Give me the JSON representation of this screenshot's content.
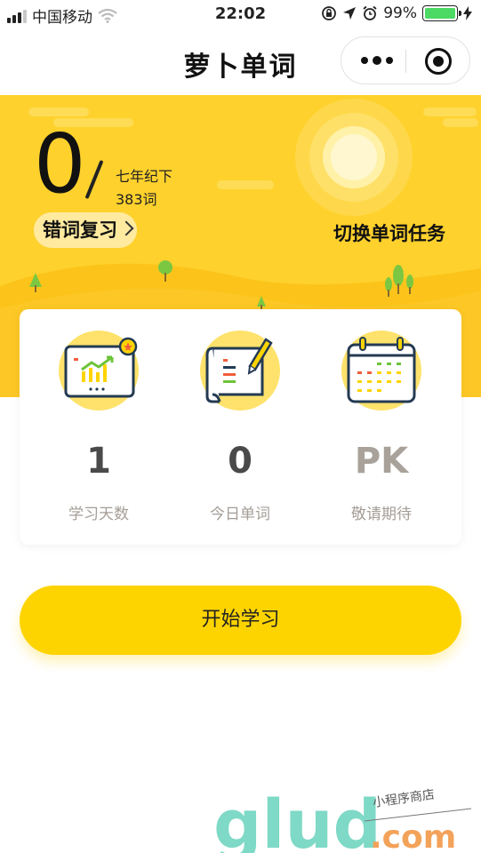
{
  "status_bar": {
    "carrier": "中国移动",
    "time": "22:02",
    "battery": "99%"
  },
  "nav": {
    "title": "萝卜单词"
  },
  "hero": {
    "word_count_big": "0",
    "book_name": "七年纪下",
    "book_total": "383词",
    "review_button": "错词复习",
    "switch_task": "切换单词任务"
  },
  "stats": [
    {
      "value": "1",
      "label": "学习天数",
      "icon": "chart-board-icon"
    },
    {
      "value": "0",
      "label": "今日单词",
      "icon": "scroll-list-icon"
    },
    {
      "value": "PK",
      "label": "敬请期待",
      "icon": "calendar-icon"
    }
  ],
  "start_button": "开始学习",
  "watermark": {
    "main": "glud",
    "suffix": ".com",
    "tagline": "小程序商店"
  },
  "colors": {
    "brand_yellow": "#fed12d",
    "button_yellow": "#fed400",
    "battery_green": "#4cd964"
  }
}
